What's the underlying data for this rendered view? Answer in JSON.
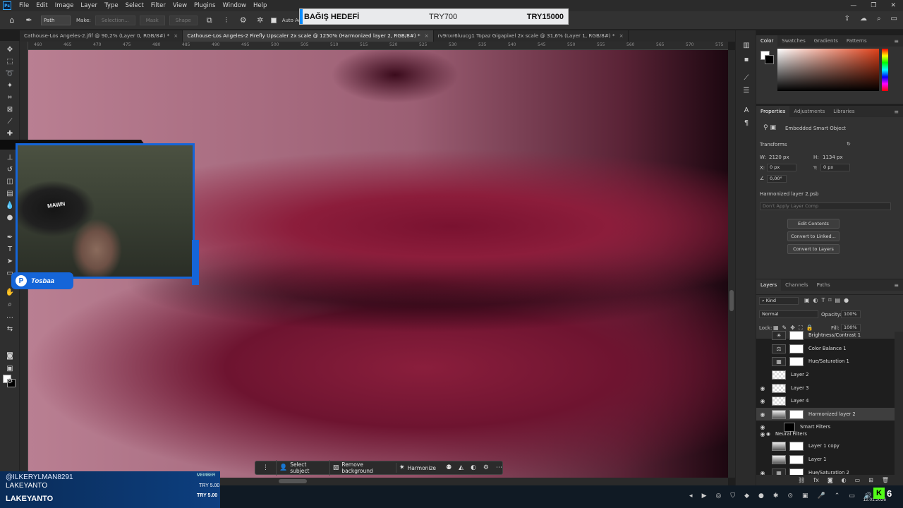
{
  "menubar": {
    "logo": "Ps",
    "items": [
      "File",
      "Edit",
      "Image",
      "Layer",
      "Type",
      "Select",
      "Filter",
      "View",
      "Plugins",
      "Window",
      "Help"
    ],
    "window_controls": [
      "—",
      "❐",
      "✕"
    ]
  },
  "options": {
    "mode": "Path",
    "make_label": "Make:",
    "selection_btn": "Selection...",
    "mask_btn": "Mask",
    "shape_btn": "Shape",
    "auto_add_delete": "Auto Add/Delete"
  },
  "donation": {
    "title": "BAĞIŞ HEDEFİ",
    "current": "TRY700",
    "goal": "TRY15000",
    "accent_color": "#0a8cff"
  },
  "tabs": [
    {
      "label": "Cathouse-Los Angeles-2.jfif @ 90,2% (Layer 0, RGB/8#) *",
      "active": false
    },
    {
      "label": "Cathouse-Los Angeles-2 Firefly Upscaler 2x scale @ 1250% (Harmonized layer 2, RGB/8#) *",
      "active": true
    },
    {
      "label": "rv9nxr6luucg1 Topaz Gigapixel 2x scale @ 31,6% (Layer 1, RGB/8#) *",
      "active": false
    }
  ],
  "ruler": {
    "ticks": [
      "460",
      "465",
      "470",
      "475",
      "480",
      "485",
      "490",
      "495",
      "500",
      "505",
      "510",
      "515",
      "520",
      "525",
      "530",
      "535",
      "540",
      "545",
      "550",
      "555",
      "560",
      "565",
      "570",
      "575"
    ]
  },
  "context_bar": {
    "select_subject": "Select subject",
    "remove_background": "Remove background",
    "harmonize": "Harmonize"
  },
  "webcam": {
    "chair_text": "MAWN",
    "brand": "Tosbaa",
    "accent_color": "#1565d8"
  },
  "stream_overlay": {
    "user": "@ILKERYLMAN8291",
    "badge": "MEMBER",
    "name1": "LAKEYANTO",
    "amount1": "TRY 5.00",
    "name2": "LAKEYANTO",
    "amount2": "TRY 5.00"
  },
  "taskbar": {
    "date": "12.01.2026",
    "kick_count": "6",
    "kick_color": "#53fc18"
  },
  "color_panel": {
    "tabs": [
      "Color",
      "Swatches",
      "Gradients",
      "Patterns"
    ]
  },
  "properties": {
    "tabs": [
      "Properties",
      "Adjustments",
      "Libraries"
    ],
    "kind": "Embedded Smart Object",
    "transforms_label": "Transforms",
    "w_label": "W:",
    "w_value": "2120 px",
    "h_label": "H:",
    "h_value": "1134 px",
    "x_label": "X:",
    "x_value": "0 px",
    "y_label": "Y:",
    "y_value": "0 px",
    "angle": "0,00°",
    "file_name": "Harmonized layer 2.psb",
    "layer_comp": "Don't Apply Layer Comp",
    "edit_contents": "Edit Contents",
    "convert_linked": "Convert to Linked...",
    "convert_layers": "Convert to Layers"
  },
  "layers_panel": {
    "tabs": [
      "Layers",
      "Channels",
      "Paths"
    ],
    "kind_filter": "Kind",
    "blend_mode": "Normal",
    "opacity_label": "Opacity:",
    "opacity": "100%",
    "lock_label": "Lock:",
    "fill_label": "Fill:",
    "fill": "100%",
    "layers": [
      {
        "name": "Brightness/Contrast 1",
        "visible": false,
        "type": "adjustment",
        "icon": "☀"
      },
      {
        "name": "Color Balance 1",
        "visible": false,
        "type": "adjustment",
        "icon": "⚖"
      },
      {
        "name": "Hue/Saturation 1",
        "visible": false,
        "type": "adjustment",
        "icon": "▦"
      },
      {
        "name": "Layer 2",
        "visible": false,
        "type": "pixel"
      },
      {
        "name": "Layer 3",
        "visible": true,
        "type": "pixel"
      },
      {
        "name": "Layer 4",
        "visible": true,
        "type": "pixel"
      },
      {
        "name": "Harmonized layer 2",
        "visible": true,
        "type": "smart",
        "selected": true
      },
      {
        "name": "Smart Filters",
        "visible": true,
        "type": "filter-group"
      },
      {
        "name": "Neural Filters",
        "visible": true,
        "type": "filter"
      },
      {
        "name": "Layer 1 copy",
        "visible": false,
        "type": "photo"
      },
      {
        "name": "Layer 1",
        "visible": false,
        "type": "photo"
      },
      {
        "name": "Hue/Saturation 2",
        "visible": true,
        "type": "adjustment",
        "icon": "▦"
      }
    ]
  }
}
